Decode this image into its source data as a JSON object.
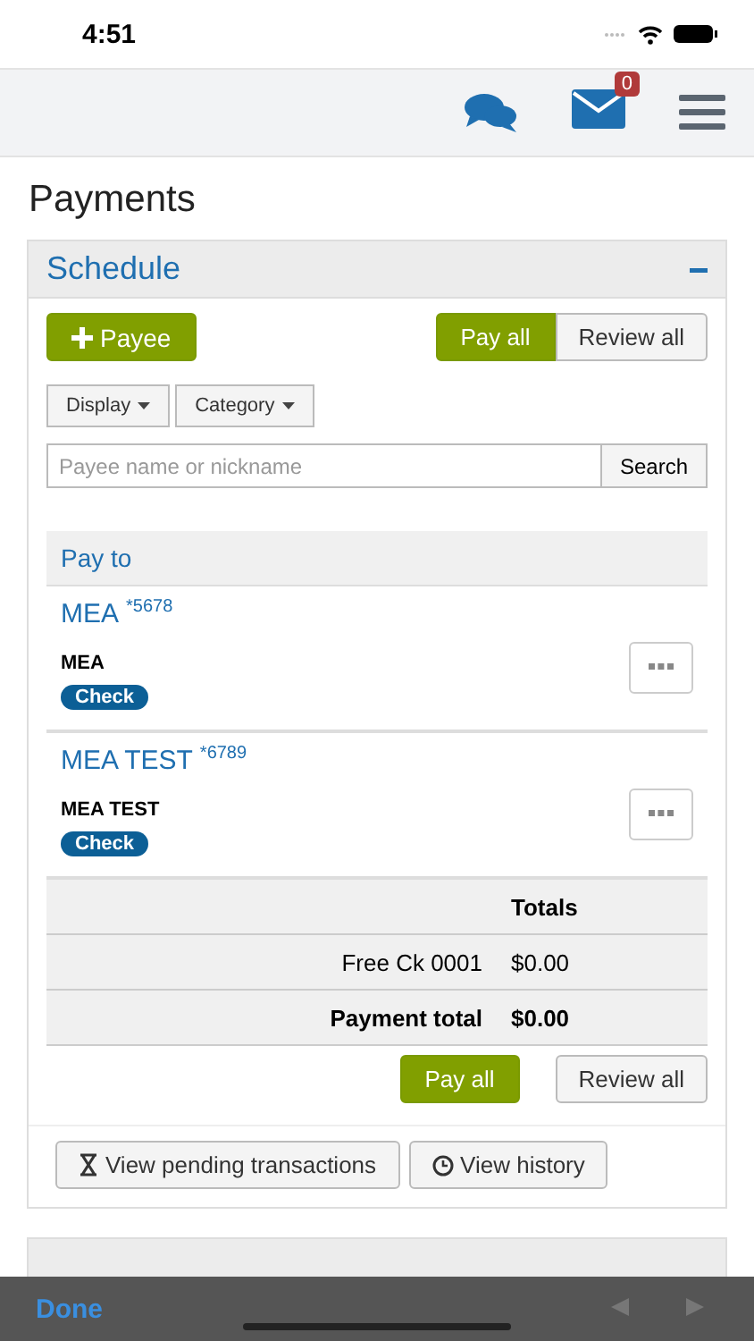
{
  "status_bar": {
    "time": "4:51"
  },
  "nav": {
    "messages_count": "0"
  },
  "page_title": "Payments",
  "schedule": {
    "title": "Schedule",
    "expanded": true,
    "add_payee": "Payee",
    "pay_all": "Pay all",
    "review_all": "Review all",
    "filters": [
      "Display",
      "Category"
    ],
    "search": {
      "placeholder": "Payee name or nickname",
      "button": "Search"
    },
    "pay_to_heading": "Pay to",
    "payees": [
      {
        "name": "MEA",
        "account": "*5678",
        "nickname": "MEA",
        "method": "Check"
      },
      {
        "name": "MEA TEST",
        "account": "*6789",
        "nickname": "MEA TEST",
        "method": "Check"
      }
    ],
    "totals": {
      "heading": "Totals",
      "rows": [
        {
          "kind": "line",
          "label": "Free Ck 0001",
          "amount": "$0.00"
        },
        {
          "kind": "grand",
          "label": "Payment total",
          "amount": "$0.00"
        }
      ]
    },
    "bottom_pay_all": "Pay all",
    "bottom_review_all": "Review all",
    "links": [
      {
        "kind": "pending",
        "label": "View pending transactions"
      },
      {
        "kind": "history",
        "label": "View history"
      }
    ]
  },
  "keyboard_bar": {
    "done": "Done",
    "prev_disabled": true,
    "next_disabled": true
  }
}
